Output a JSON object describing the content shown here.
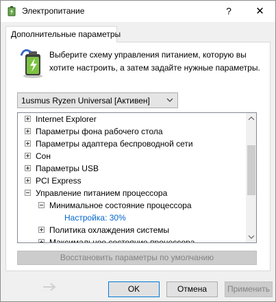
{
  "window": {
    "title": "Электропитание",
    "help_glyph": "?",
    "close_glyph": "✕",
    "icon": "battery-icon"
  },
  "tab": {
    "label": "Дополнительные параметры"
  },
  "description": "Выберите схему управления питанием, которую вы хотите настроить, а затем задайте нужные параметры.",
  "scheme": {
    "selected": "1usmus Ryzen Universal [Активен]"
  },
  "tree": {
    "items": [
      {
        "label": "Internet Explorer",
        "state": "collapsed"
      },
      {
        "label": "Параметры фона рабочего стола",
        "state": "collapsed"
      },
      {
        "label": "Параметры адаптера беспроводной сети",
        "state": "collapsed"
      },
      {
        "label": "Сон",
        "state": "collapsed"
      },
      {
        "label": "Параметры USB",
        "state": "collapsed"
      },
      {
        "label": "PCI Express",
        "state": "collapsed"
      },
      {
        "label": "Управление питанием процессора",
        "state": "expanded"
      },
      {
        "label": "Минимальное состояние процессора",
        "state": "expanded"
      },
      {
        "label": "Настройка: 30%",
        "state": "value"
      },
      {
        "label": "Политика охлаждения системы",
        "state": "collapsed"
      },
      {
        "label": "Максимальное состояние процессора",
        "state": "collapsed"
      }
    ]
  },
  "buttons": {
    "restore": "Восстановить параметры по умолчанию",
    "ok": "OK",
    "cancel": "Отмена",
    "apply": "Применить"
  },
  "colors": {
    "setting_value": "#0066cc",
    "accent": "#0078d7"
  }
}
